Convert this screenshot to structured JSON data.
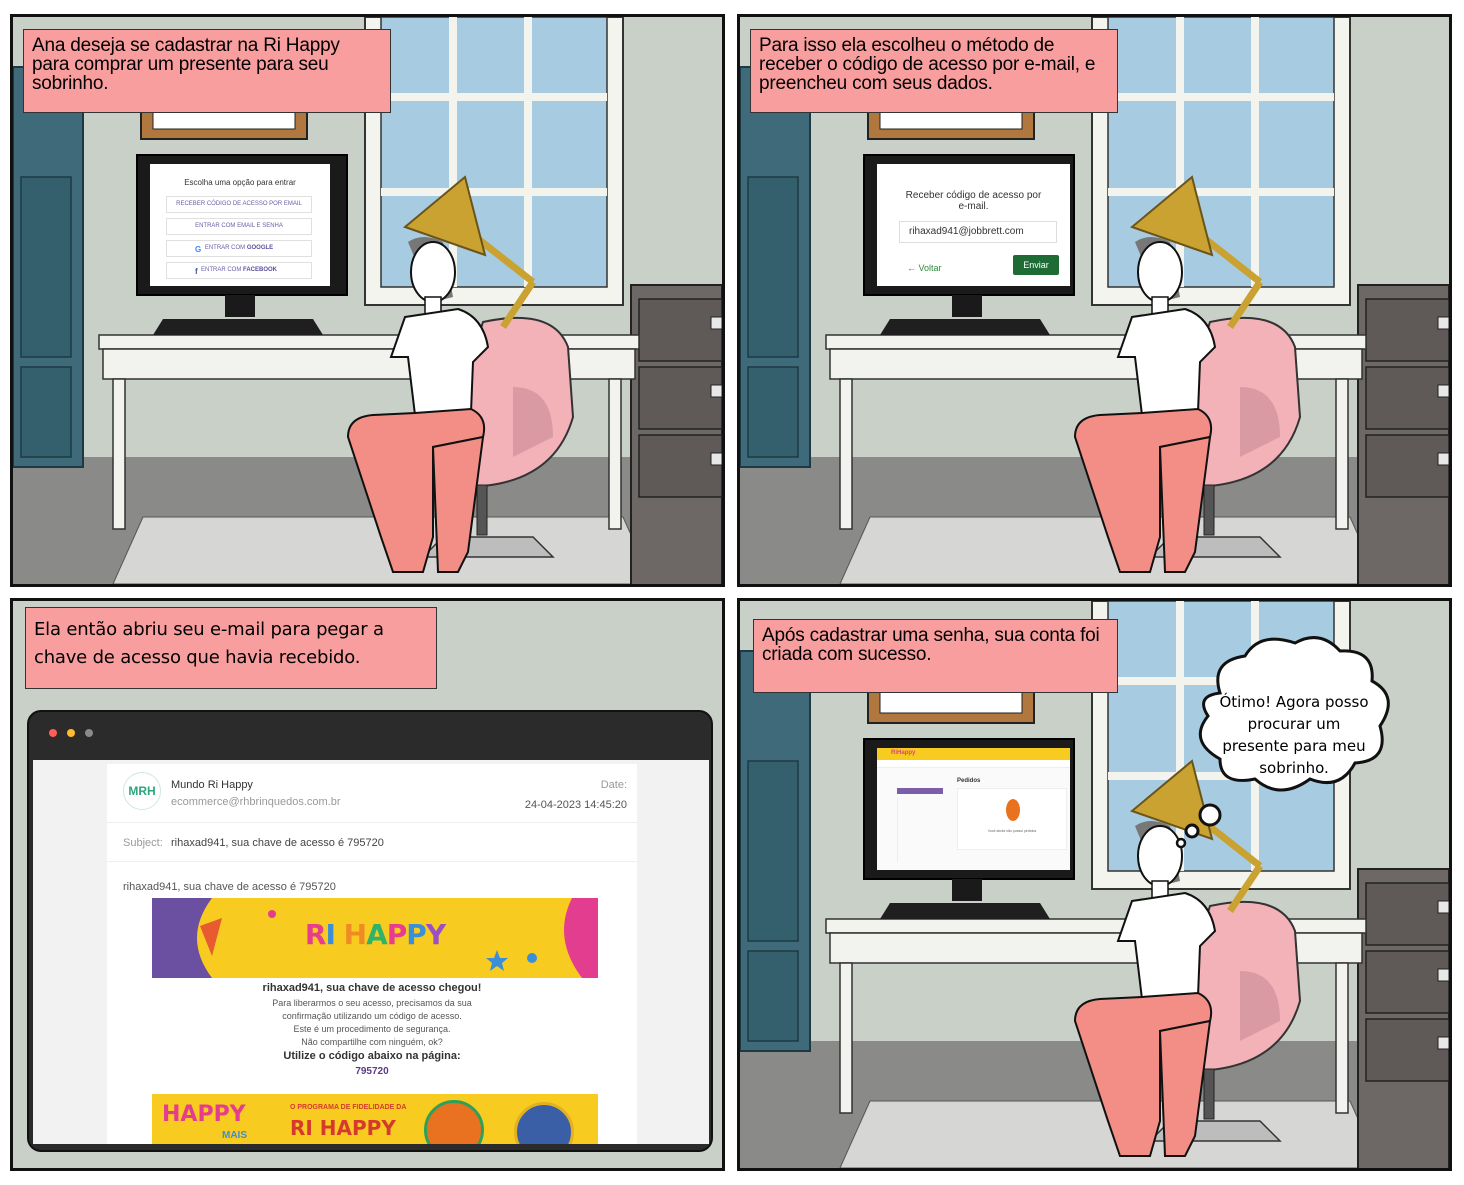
{
  "panels": {
    "p1": {
      "caption": "Ana deseja se cadastrar na Ri Happy para comprar um presente para seu sobrinho.",
      "screen": {
        "title": "Escolha uma opção para entrar",
        "options": [
          {
            "label": "RECEBER CÓDIGO DE ACESSO POR EMAIL"
          },
          {
            "label": "ENTRAR COM EMAIL E SENHA"
          },
          {
            "label_prefix": "ENTRAR COM",
            "label_strong": "GOOGLE",
            "icon": "google-icon"
          },
          {
            "label_prefix": "ENTRAR COM",
            "label_strong": "FACEBOOK",
            "icon": "facebook-icon"
          }
        ]
      }
    },
    "p2": {
      "caption": "Para isso ela escolheu o método de receber o código de acesso por e-mail, e preencheu com seus dados.",
      "screen": {
        "title": "Receber código de acesso por e-mail.",
        "email": "rihaxad941@jobbrett.com",
        "back": "← Voltar",
        "send": "Enviar"
      }
    },
    "p3": {
      "caption": "Ela então abriu seu e-mail para pegar a chave de acesso que havia recebido.",
      "email": {
        "avatar": "MRH",
        "sender": "Mundo Ri Happy",
        "sender_email": "ecommerce@rhbrinquedos.com.br",
        "date_label": "Date:",
        "date": "24-04-2023 14:45:20",
        "subject_label": "Subject:",
        "subject": "rihaxad941, sua chave de acesso é 795720",
        "preview": "rihaxad941, sua chave de acesso é 795720",
        "banner_logo": "RI HAPPY",
        "heading": "rihaxad941, sua chave de acesso chegou!",
        "paragraph": [
          "Para liberarmos o seu acesso, precisamos da sua",
          "confirmação utilizando um código de acesso.",
          "Este é um procedimento de segurança.",
          "Não compartilhe com ninguém, ok?"
        ],
        "code_heading": "Utilize o código abaixo na página:",
        "code": "795720",
        "footer_banner": {
          "logo": "HAPPY",
          "logo_sub": "MAIS",
          "program": "O PROGRAMA DE FIDELIDADE DA",
          "brand": "RI HAPPY"
        }
      }
    },
    "p4": {
      "caption": "Após cadastrar uma senha, sua conta foi criada com sucesso.",
      "screen": {
        "brand": "RiHappy",
        "page_title": "Pedidos",
        "empty_text": "Você ainda não possui pedidos"
      },
      "thought": "Ótimo! Agora posso procurar um presente para meu sobrinho."
    }
  },
  "colors": {
    "caption_bg": "#f99e9e",
    "wall": "#c9d0c8",
    "window_sky": "#a7cbe0",
    "pants": "#f28e86",
    "chair": "#f3b2b8",
    "lamp": "#c9a232",
    "cabinet_blue": "#3e6a79",
    "file_cabinet": "#6d6866"
  }
}
